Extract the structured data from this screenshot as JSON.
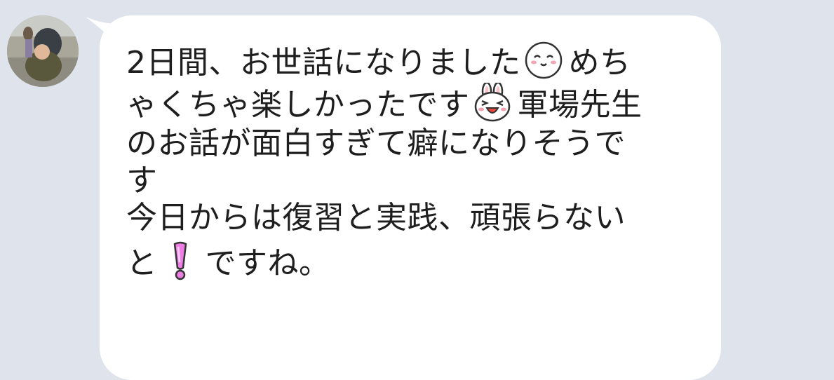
{
  "chat": {
    "sender_avatar": "avatar-photo",
    "message": {
      "line1_a": "2日間、お世話になりました",
      "line1_b": "めち",
      "line2_a": "ゃくちゃ楽しかったです",
      "line2_b": "軍場先生",
      "line3": "のお話が面白すぎて癖になりそうで",
      "line4": "す",
      "line5": "今日からは復習と実践、頑張らない",
      "line6_a": "と",
      "line6_b": "ですね。"
    },
    "emojis": {
      "first": "smiling-face-icon",
      "second": "laughing-bunny-icon",
      "third": "pink-exclamation-icon"
    }
  },
  "colors": {
    "background": "#dfe4ec",
    "bubble": "#ffffff",
    "text": "#1e1e1e",
    "exclamation": "#ee7ee6"
  }
}
